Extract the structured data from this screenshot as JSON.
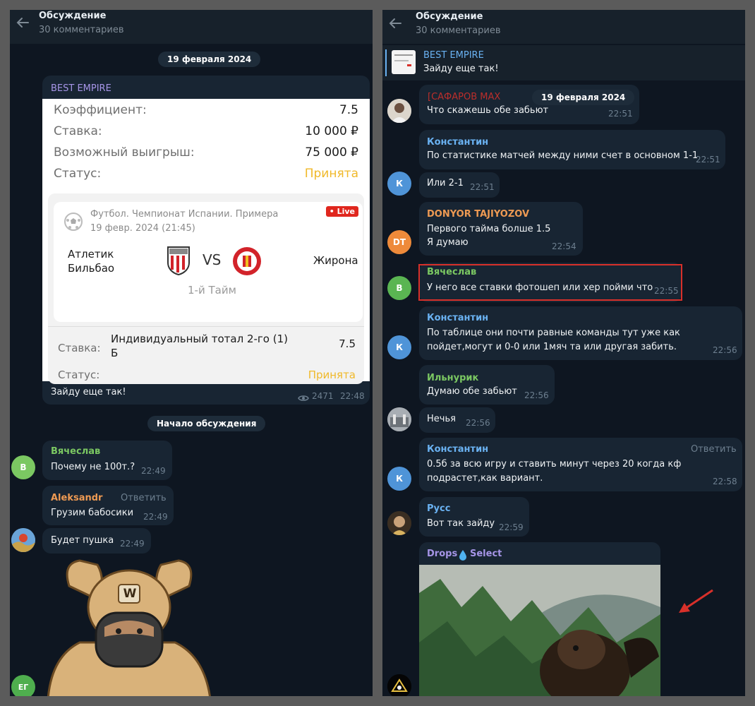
{
  "left": {
    "header": {
      "title": "Обсуждение",
      "subtitle": "30 комментариев"
    },
    "date_pill": "19 февраля 2024",
    "post": {
      "channel": "BEST EMPIRE",
      "coef_label": "Коэффициент:",
      "coef_value": "7.5",
      "stake_label": "Ставка:",
      "stake_value": "10 000 ₽",
      "win_label": "Возможный выигрыш:",
      "win_value": "75 000 ₽",
      "status_label": "Статус:",
      "status_value": "Принята",
      "match": {
        "league": "Футбол. Чемпионат Испании. Примера",
        "datetime": "19 февр. 2024 (21:45)",
        "live": "• Live",
        "team1": "Атлетик Бильбао",
        "vs": "VS",
        "team2": "Жирона",
        "period": "1-й Тайм"
      },
      "bet_label": "Ставка:",
      "bet_desc": "Индивидуальный тотал 2-го (1) Б",
      "bet_coef": "7.5",
      "bet_status_label": "Статус:",
      "bet_status_value": "Принята",
      "caption": "Зайду еще так!",
      "views": "2471",
      "time": "22:48"
    },
    "start_pill": "Начало обсуждения",
    "messages": [
      {
        "sender": "Вячеслав",
        "text": "Почему не 100т.?",
        "time": "22:49",
        "avatar": "В"
      },
      {
        "sender": "Aleksandr",
        "reply": "Ответить",
        "text": "Грузим бабосики",
        "time": "22:49"
      },
      {
        "text": "Будет пушка",
        "time": "22:49"
      }
    ],
    "sticker_letter": "W",
    "bottom_avatar": "ЕГ"
  },
  "right": {
    "header": {
      "title": "Обсуждение",
      "subtitle": "30 комментариев"
    },
    "pinned": {
      "title": "BEST EMPIRE",
      "text": "Зайду еще так!"
    },
    "messages": [
      {
        "sender": "[САФАРОВ МАХ",
        "pill": "19 февраля 2024",
        "text": "Что скажешь обе забьют",
        "time": "22:51"
      },
      {
        "sender": "Константин",
        "text": "По статистике матчей между ними счет в основном 1-1",
        "time": "22:51"
      },
      {
        "text": "Или 2-1",
        "time": "22:51",
        "avatar": "К"
      },
      {
        "sender": "DONYOR TAJIYOZOV",
        "line1": "Первого тайма болше 1.5",
        "line2": "Я думаю",
        "time": "22:54",
        "avatar": "DT"
      },
      {
        "sender": "Вячеслав",
        "text": "У него все ставки фотошеп или хер пойми что",
        "time": "22:55",
        "avatar": "В"
      },
      {
        "sender": "Константин",
        "text": "По таблице они почти равные команды тут уже как пойдет,могут и 0-0 или 1мяч та или другая забить.",
        "time": "22:56",
        "avatar": "К"
      },
      {
        "sender": "Ильнурик",
        "text": "Думаю обе забьют",
        "time": "22:56"
      },
      {
        "text": "Нечья",
        "time": "22:56"
      },
      {
        "sender": "Константин",
        "reply": "Ответить",
        "text": "0.5б за всю игру и ставить минут через 20 когда кф подрастет,как вариант.",
        "time": "22:58",
        "avatar": "К"
      },
      {
        "sender": "Русс",
        "text": "Вот так зайду",
        "time": "22:59"
      },
      {
        "sender_a": "Drops",
        "sender_b": "Select"
      }
    ]
  },
  "colors": {
    "bg": "#0e1621",
    "header": "#17212b",
    "bubble": "#182533",
    "accent_purple": "#a695e7",
    "accent_blue": "#6ab2f2",
    "accent_green": "#7bc862",
    "accent_orange": "#ee9a53",
    "status_yellow": "#f0b92a",
    "highlight_red": "#d8302a"
  }
}
